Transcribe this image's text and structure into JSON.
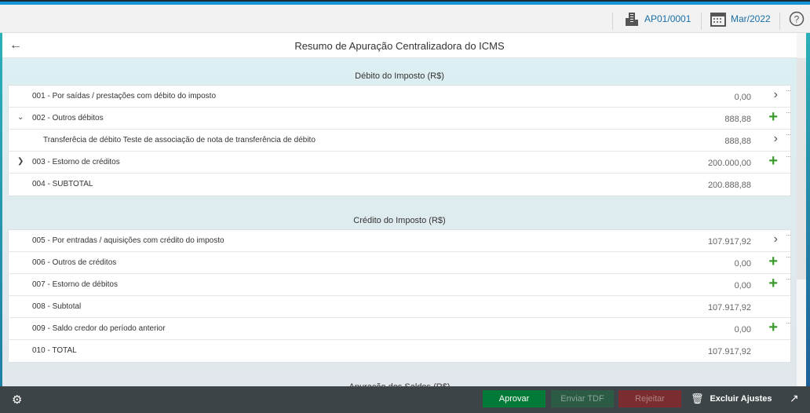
{
  "header": {
    "company": "AP01/0001",
    "period": "Mar/2022"
  },
  "page": {
    "title": "Resumo de Apuração Centralizadora do ICMS"
  },
  "sections": [
    {
      "title": "Débito do Imposto (R$)",
      "rows": [
        {
          "label": "001 - Por saídas / prestações com débito do imposto",
          "value": "0,00",
          "action": "chevron"
        },
        {
          "label": "002 - Outros débitos",
          "value": "888,88",
          "action": "plus",
          "toggle": "⌄"
        },
        {
          "label": "Transferêcia de débito Teste de associação de nota de transferência de débito",
          "value": "888,88",
          "action": "chevron",
          "sub": true
        },
        {
          "label": "003 - Estorno de créditos",
          "value": "200.000,00",
          "action": "plus",
          "toggle": "❯"
        },
        {
          "label": "004 - SUBTOTAL",
          "value": "200.888,88",
          "action": ""
        }
      ]
    },
    {
      "title": "Crédito do Imposto (R$)",
      "rows": [
        {
          "label": "005 - Por entradas / aquisições com crédito do imposto",
          "value": "107.917,92",
          "action": "chevron"
        },
        {
          "label": "006 - Outros de créditos",
          "value": "0,00",
          "action": "plus"
        },
        {
          "label": "007 - Estorno de débitos",
          "value": "0,00",
          "action": "plus"
        },
        {
          "label": "008 - Subtotal",
          "value": "107.917,92",
          "action": ""
        },
        {
          "label": "009 - Saldo credor do período anterior",
          "value": "0,00",
          "action": "plus"
        },
        {
          "label": "010 - TOTAL",
          "value": "107.917,92",
          "action": ""
        }
      ]
    },
    {
      "title": "Apuração dos Saldos (R$)",
      "rows": []
    }
  ],
  "footer": {
    "approve": "Aprovar",
    "send_tdf": "Enviar TDF",
    "reject": "Rejeitar",
    "delete_adjustments": "Excluir Ajustes"
  },
  "colors": {
    "approve": "#027a37",
    "send_tdf": "#2b5a45",
    "reject": "#7a2c30",
    "accent": "#1496d8"
  }
}
